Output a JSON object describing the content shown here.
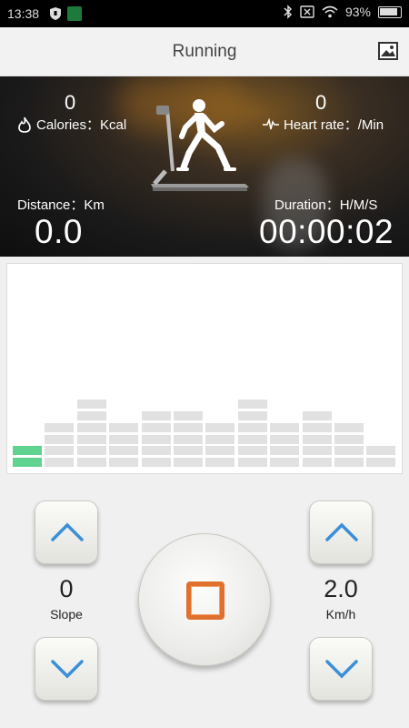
{
  "status_bar": {
    "time": "13:38",
    "battery": "93%"
  },
  "header": {
    "title": "Running"
  },
  "stats": {
    "calories": {
      "value": "0",
      "label": "Calories：Kcal"
    },
    "heart_rate": {
      "value": "0",
      "label": "Heart rate：/Min"
    },
    "distance": {
      "value": "0.0",
      "label": "Distance：Km"
    },
    "duration": {
      "value": "00:00:02",
      "label": "Duration：H/M/S"
    }
  },
  "equalizer": {
    "levels": [
      2,
      4,
      6,
      4,
      5,
      5,
      4,
      6,
      4,
      5,
      4,
      2
    ],
    "active_column": 0,
    "active_color": "#5fd38f",
    "inactive_color": "#e1e1e1"
  },
  "controls": {
    "slope": {
      "value": "0",
      "label": "Slope"
    },
    "speed": {
      "value": "2.0",
      "label": "Km/h"
    }
  },
  "colors": {
    "accent_arrow": "#3a8fd9",
    "stop_orange": "#e0702e"
  }
}
